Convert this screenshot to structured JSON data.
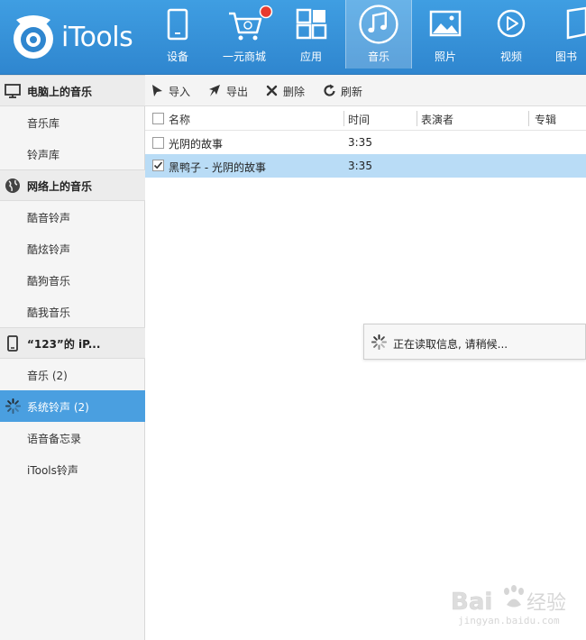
{
  "app": {
    "name": "iTools"
  },
  "nav": {
    "items": [
      {
        "label": "设备",
        "icon": "phone-icon"
      },
      {
        "label": "一元商城",
        "icon": "cart-icon",
        "badge": true
      },
      {
        "label": "应用",
        "icon": "apps-grid-icon"
      },
      {
        "label": "音乐",
        "icon": "music-note-icon",
        "active": true
      },
      {
        "label": "照片",
        "icon": "photo-icon"
      },
      {
        "label": "视频",
        "icon": "play-icon"
      },
      {
        "label": "图书",
        "icon": "book-icon"
      }
    ]
  },
  "sidebar": {
    "sections": [
      {
        "title": "电脑上的音乐",
        "icon": "monitor-icon",
        "items": [
          "音乐库",
          "铃声库"
        ]
      },
      {
        "title": "网络上的音乐",
        "icon": "globe-icon",
        "items": [
          "酷音铃声",
          "酷炫铃声",
          "酷狗音乐",
          "酷我音乐"
        ]
      },
      {
        "title": "“123”的 iP...",
        "icon": "device-icon",
        "items": [
          "音乐 (2)",
          "系统铃声 (2)",
          "语音备忘录",
          "iTools铃声"
        ]
      }
    ],
    "active_item": "系统铃声 (2)"
  },
  "toolbar": {
    "import": "导入",
    "export": "导出",
    "delete": "删除",
    "refresh": "刷新"
  },
  "table": {
    "columns": {
      "name": "名称",
      "time": "时间",
      "artist": "表演者",
      "album": "专辑"
    },
    "rows": [
      {
        "name": "光阴的故事",
        "time": "3:35",
        "checked": false,
        "selected": false
      },
      {
        "name": "黑鸭子 - 光阴的故事",
        "time": "3:35",
        "checked": true,
        "selected": true
      }
    ]
  },
  "loading": {
    "text": "正在读取信息, 请稍候..."
  },
  "watermark": {
    "brand": "Baidu经验",
    "url": "jingyan.baidu.com"
  },
  "colors": {
    "topbar": "#3a97dd",
    "active_sidebar": "#4a9fe0",
    "selected_row": "#b9dcf6",
    "badge": "#e83a2e"
  }
}
